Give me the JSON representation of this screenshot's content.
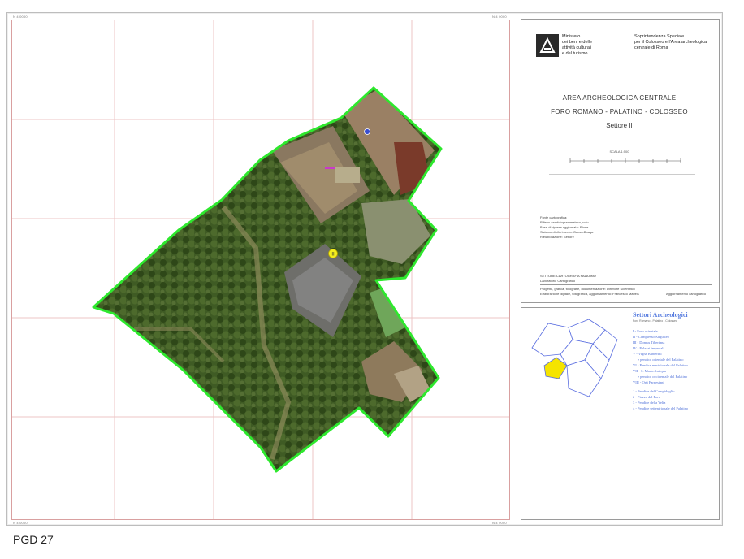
{
  "page": {
    "footer_label": "PGD 27"
  },
  "map": {
    "coords": {
      "label": "N 4 0000"
    },
    "markers": [
      {
        "label": "II",
        "kind": "yellow-marker"
      },
      {
        "label": "",
        "kind": "blue-marker"
      }
    ],
    "colors": {
      "boundary": "#2ee82e",
      "grid": "#e6a8a8",
      "vegetation": "#3d5a22"
    }
  },
  "titleblock": {
    "ministry": [
      "Ministero",
      "dei beni e delle",
      "attività culturali",
      "e del turismo"
    ],
    "agency": [
      "Soprintendenza Speciale",
      "per il Colosseo e l'Area archeologica",
      "centrale di Roma"
    ],
    "area_title": "AREA ARCHEOLOGICA CENTRALE",
    "area_subtitle": "FORO ROMANO - PALATINO - COLOSSEO",
    "sector": "Settore II",
    "scale": "SCALA 1:500",
    "notes": [
      "Fonte cartografica:",
      "Rilievo aerofotogrammetrico, volo",
      "Base di ripresa aggiornata: Rione",
      "Sistema di riferimento: Gauss-Boaga",
      "Rielaborazione: Settore"
    ],
    "office": "SETTORE CARTOGRAFIA PALATINO",
    "office_sub": "Laboratorio Cartografico",
    "credits_1": "Progetto, grafica, fotografie, documentazione: Direttore Scientifico",
    "credits_2": "Elaborazione digitale, fotografica, aggiornamento: Francesco Maffeis",
    "date_label": "Aggiornamento cartografico"
  },
  "legend": {
    "title": "Settori Archeologici",
    "subtitle": "Foro Romano - Palatino - Colosseo",
    "items": [
      "I - Foro orientale",
      "II - Complesso Augusteo",
      "III - Domus Tiberiana",
      "IV - Palazzi imperiali",
      "V - Vigna Barberini",
      "e pendice orientale del Palatino",
      "VI - Pendice meridionale del Palatino",
      "VII - S. Maria Antiqua",
      "e pendice occidentale del Palatino",
      "VIII - Orti Farnesiani",
      "1 - Pendice del Campidoglio",
      "2 - Piazza del Foro",
      "3 - Pendice della Velia",
      "4 - Pendice settentrionale del Palatino"
    ],
    "highlight_color": "#f5e400"
  }
}
